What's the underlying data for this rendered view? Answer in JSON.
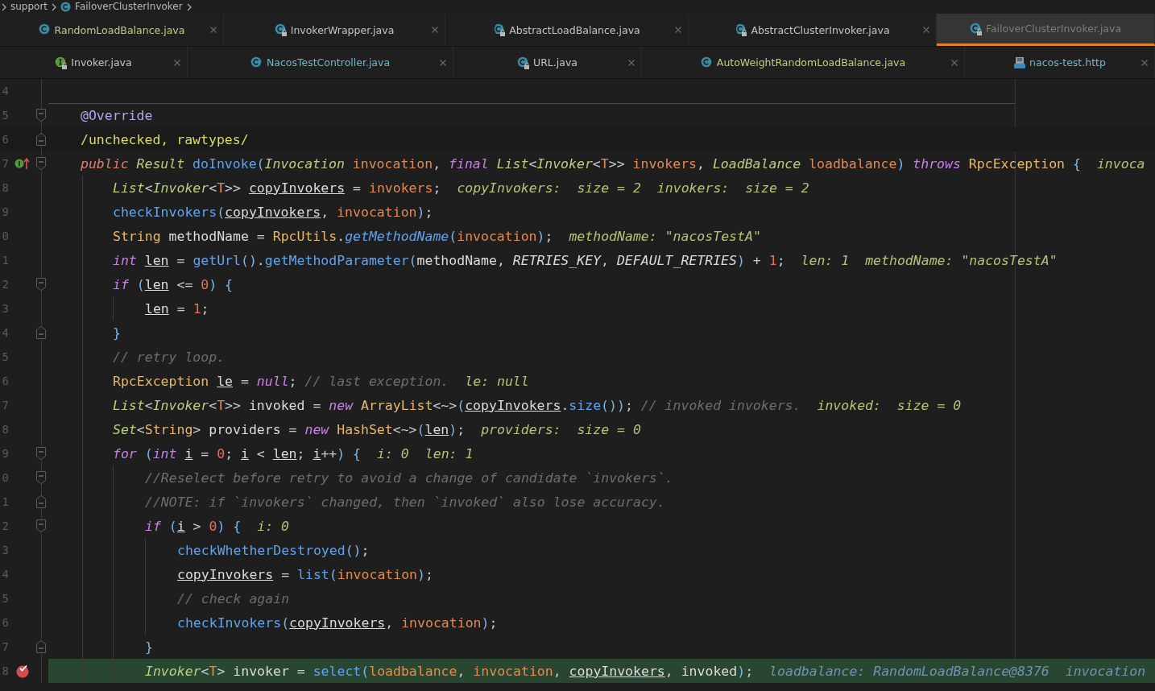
{
  "breadcrumb": [
    "support",
    "FailoverClusterInvoker"
  ],
  "tab_rows": [
    [
      {
        "label": "RandomLoadBalance.java",
        "kind": "class",
        "color": "#b7cf7e",
        "selected": false
      },
      {
        "label": "InvokerWrapper.java",
        "kind": "locked-class",
        "color": "#c4c4c4",
        "selected": false
      },
      {
        "label": "AbstractLoadBalance.java",
        "kind": "locked-abstract",
        "color": "#c4c4c4",
        "selected": false
      },
      {
        "label": "AbstractClusterInvoker.java",
        "kind": "locked-abstract",
        "color": "#c4c4c4",
        "selected": false
      },
      {
        "label": "FailoverClusterInvoker.java",
        "kind": "locked-class",
        "color": "#7d7d7d",
        "selected": true
      }
    ],
    [
      {
        "label": "Invoker.java",
        "kind": "locked-interface",
        "color": "#c4c4c4",
        "selected": false
      },
      {
        "label": "NacosTestController.java",
        "kind": "class",
        "color": "#72b4c8",
        "selected": false
      },
      {
        "label": "URL.java",
        "kind": "locked-class",
        "color": "#c4c4c4",
        "selected": false
      },
      {
        "label": "AutoWeightRandomLoadBalance.java",
        "kind": "class",
        "color": "#b7cf7e",
        "selected": false
      },
      {
        "label": "nacos-test.http",
        "kind": "http",
        "color": "#72b4c8",
        "selected": false
      }
    ]
  ],
  "lines": [
    {
      "number": "4"
    },
    {
      "number": "5",
      "fold_start": true,
      "method_separator": true,
      "tokens": [
        {
          "kind": "ann",
          "text": "@Override"
        }
      ]
    },
    {
      "number": "6",
      "fold_end": true,
      "caret_line": true,
      "tokens": [
        {
          "kind": "sup",
          "text": "/unchecked, rawtypes/"
        }
      ]
    },
    {
      "number": "7",
      "fold_start": true,
      "implements_marker": true,
      "tokens": [
        {
          "kind": "mod",
          "text": "public "
        },
        {
          "kind": "ty",
          "text": "Result "
        },
        {
          "kind": "fn",
          "text": "doInvoke"
        },
        {
          "kind": "br",
          "text": "("
        },
        {
          "kind": "ty",
          "text": "Invocation "
        },
        {
          "kind": "par",
          "text": "invocation"
        },
        {
          "text": ", "
        },
        {
          "kind": "kw",
          "text": "final "
        },
        {
          "kind": "ty",
          "text": "List"
        },
        {
          "text": "<"
        },
        {
          "kind": "ty",
          "text": "Invoker"
        },
        {
          "text": "<"
        },
        {
          "kind": "tp",
          "text": "T"
        },
        {
          "text": ">> "
        },
        {
          "kind": "par",
          "text": "invokers"
        },
        {
          "text": ", "
        },
        {
          "kind": "ty",
          "text": "LoadBalance "
        },
        {
          "kind": "par",
          "text": "loadbalance"
        },
        {
          "kind": "br",
          "text": ")"
        },
        {
          "kind": "kw",
          "text": " throws "
        },
        {
          "kind": "cls",
          "text": "RpcException "
        },
        {
          "kind": "br",
          "text": "{"
        }
      ],
      "hints": [
        "invoca"
      ],
      "children": [
        {
          "number": "8",
          "tokens": [
            {
              "kind": "ty",
              "text": "List"
            },
            {
              "text": "<"
            },
            {
              "kind": "ty",
              "text": "Invoker"
            },
            {
              "text": "<"
            },
            {
              "kind": "tp",
              "text": "T"
            },
            {
              "text": ">> "
            },
            {
              "kind": "u",
              "text": "copyInvokers"
            },
            {
              "text": " = "
            },
            {
              "kind": "par",
              "text": "invokers"
            },
            {
              "text": ";"
            }
          ],
          "hints": [
            "copyInvokers:  size = 2",
            "invokers:  size = 2"
          ]
        },
        {
          "number": "9",
          "tokens": [
            {
              "kind": "fn",
              "text": "checkInvokers"
            },
            {
              "kind": "br",
              "text": "("
            },
            {
              "kind": "u",
              "text": "copyInvokers"
            },
            {
              "text": ", "
            },
            {
              "kind": "par",
              "text": "invocation"
            },
            {
              "kind": "br",
              "text": ")"
            },
            {
              "text": ";"
            }
          ]
        },
        {
          "number": "0",
          "tokens": [
            {
              "kind": "cls",
              "text": "String "
            },
            {
              "kind": "v",
              "text": "methodName"
            },
            {
              "text": " = "
            },
            {
              "kind": "cls",
              "text": "RpcUtils"
            },
            {
              "text": "."
            },
            {
              "kind": "sfn",
              "text": "getMethodName"
            },
            {
              "kind": "br",
              "text": "("
            },
            {
              "kind": "par",
              "text": "invocation"
            },
            {
              "kind": "br",
              "text": ")"
            },
            {
              "text": ";"
            }
          ],
          "hints": [
            "methodName: \"nacosTestA\""
          ]
        },
        {
          "number": "1",
          "tokens": [
            {
              "kind": "kw",
              "text": "int "
            },
            {
              "kind": "u",
              "text": "len"
            },
            {
              "text": " = "
            },
            {
              "kind": "fn",
              "text": "getUrl"
            },
            {
              "kind": "br",
              "text": "()"
            },
            {
              "text": "."
            },
            {
              "kind": "fn",
              "text": "getMethodParameter"
            },
            {
              "kind": "br",
              "text": "("
            },
            {
              "kind": "v",
              "text": "methodName"
            },
            {
              "text": ", "
            },
            {
              "kind": "cst",
              "text": "RETRIES_KEY"
            },
            {
              "text": ", "
            },
            {
              "kind": "cst",
              "text": "DEFAULT_RETRIES"
            },
            {
              "kind": "br",
              "text": ")"
            },
            {
              "text": " + "
            },
            {
              "kind": "num",
              "text": "1"
            },
            {
              "text": ";"
            }
          ],
          "hints": [
            "len: 1",
            "methodName: \"nacosTestA\""
          ]
        },
        {
          "number": "2",
          "fold_start": true,
          "tokens": [
            {
              "kind": "kw",
              "text": "if "
            },
            {
              "kind": "br",
              "text": "("
            },
            {
              "kind": "u",
              "text": "len"
            },
            {
              "text": " <= "
            },
            {
              "kind": "num",
              "text": "0"
            },
            {
              "kind": "br",
              "text": ") {"
            }
          ],
          "children": [
            {
              "number": "3",
              "tokens": [
                {
                  "kind": "u",
                  "text": "len"
                },
                {
                  "text": " = "
                },
                {
                  "kind": "num",
                  "text": "1"
                },
                {
                  "text": ";"
                }
              ]
            }
          ]
        },
        {
          "number": "4",
          "fold_end": true,
          "tokens": [
            {
              "kind": "br",
              "text": "}"
            }
          ]
        },
        {
          "number": "5",
          "tokens": [
            {
              "kind": "cm",
              "text": "// retry loop."
            }
          ]
        },
        {
          "number": "6",
          "tokens": [
            {
              "kind": "cls",
              "text": "RpcException "
            },
            {
              "kind": "u",
              "text": "le"
            },
            {
              "text": " = "
            },
            {
              "kind": "kw",
              "text": "null"
            },
            {
              "text": "; "
            },
            {
              "kind": "cm",
              "text": "// last exception."
            }
          ],
          "hints": [
            "le: null"
          ]
        },
        {
          "number": "7",
          "tokens": [
            {
              "kind": "ty",
              "text": "List"
            },
            {
              "text": "<"
            },
            {
              "kind": "ty",
              "text": "Invoker"
            },
            {
              "text": "<"
            },
            {
              "kind": "tp",
              "text": "T"
            },
            {
              "text": ">> "
            },
            {
              "kind": "v",
              "text": "invoked"
            },
            {
              "text": " = "
            },
            {
              "kind": "kw",
              "text": "new "
            },
            {
              "kind": "cls",
              "text": "ArrayList"
            },
            {
              "text": "<~>"
            },
            {
              "kind": "br",
              "text": "("
            },
            {
              "kind": "u",
              "text": "copyInvokers"
            },
            {
              "text": "."
            },
            {
              "kind": "fn",
              "text": "size"
            },
            {
              "kind": "br",
              "text": "())"
            },
            {
              "text": "; "
            },
            {
              "kind": "cm",
              "text": "// invoked invokers."
            }
          ],
          "hints": [
            "invoked:  size = 0"
          ]
        },
        {
          "number": "8",
          "tokens": [
            {
              "kind": "ty",
              "text": "Set"
            },
            {
              "text": "<"
            },
            {
              "kind": "cls",
              "text": "String"
            },
            {
              "text": "> "
            },
            {
              "kind": "v",
              "text": "providers"
            },
            {
              "text": " = "
            },
            {
              "kind": "kw",
              "text": "new "
            },
            {
              "kind": "cls",
              "text": "HashSet"
            },
            {
              "text": "<~>"
            },
            {
              "kind": "br",
              "text": "("
            },
            {
              "kind": "u",
              "text": "len"
            },
            {
              "kind": "br",
              "text": ")"
            },
            {
              "text": ";"
            }
          ],
          "hints": [
            "providers:  size = 0"
          ]
        },
        {
          "number": "9",
          "fold_start": true,
          "tokens": [
            {
              "kind": "kw",
              "text": "for "
            },
            {
              "kind": "br",
              "text": "("
            },
            {
              "kind": "kw",
              "text": "int "
            },
            {
              "kind": "u",
              "text": "i"
            },
            {
              "text": " = "
            },
            {
              "kind": "num",
              "text": "0"
            },
            {
              "text": "; "
            },
            {
              "kind": "u",
              "text": "i"
            },
            {
              "text": " < "
            },
            {
              "kind": "u",
              "text": "len"
            },
            {
              "text": "; "
            },
            {
              "kind": "u",
              "text": "i"
            },
            {
              "text": "++"
            },
            {
              "kind": "br",
              "text": ") {"
            }
          ],
          "hints": [
            "i: 0",
            "len: 1"
          ],
          "children": [
            {
              "number": "0",
              "fold_start": true,
              "tokens": [
                {
                  "kind": "cm",
                  "text": "//Reselect before retry to avoid a change of candidate `invokers`."
                }
              ]
            },
            {
              "number": "1",
              "fold_end": true,
              "tokens": [
                {
                  "kind": "cm",
                  "text": "//NOTE: if `invokers` changed, then `invoked` also lose accuracy."
                }
              ]
            },
            {
              "number": "2",
              "fold_start": true,
              "tokens": [
                {
                  "kind": "kw",
                  "text": "if "
                },
                {
                  "kind": "br",
                  "text": "("
                },
                {
                  "kind": "u",
                  "text": "i"
                },
                {
                  "text": " > "
                },
                {
                  "kind": "num",
                  "text": "0"
                },
                {
                  "kind": "br",
                  "text": ") {"
                }
              ],
              "hints": [
                "i: 0"
              ],
              "children": [
                {
                  "number": "3",
                  "tokens": [
                    {
                      "kind": "fn",
                      "text": "checkWhetherDestroyed"
                    },
                    {
                      "kind": "br",
                      "text": "()"
                    },
                    {
                      "text": ";"
                    }
                  ]
                },
                {
                  "number": "4",
                  "tokens": [
                    {
                      "kind": "u",
                      "text": "copyInvokers"
                    },
                    {
                      "text": " = "
                    },
                    {
                      "kind": "fn",
                      "text": "list"
                    },
                    {
                      "kind": "br",
                      "text": "("
                    },
                    {
                      "kind": "par",
                      "text": "invocation"
                    },
                    {
                      "kind": "br",
                      "text": ")"
                    },
                    {
                      "text": ";"
                    }
                  ]
                },
                {
                  "number": "5",
                  "tokens": [
                    {
                      "kind": "cm",
                      "text": "// check again"
                    }
                  ]
                },
                {
                  "number": "6",
                  "tokens": [
                    {
                      "kind": "fn",
                      "text": "checkInvokers"
                    },
                    {
                      "kind": "br",
                      "text": "("
                    },
                    {
                      "kind": "u",
                      "text": "copyInvokers"
                    },
                    {
                      "text": ", "
                    },
                    {
                      "kind": "par",
                      "text": "invocation"
                    },
                    {
                      "kind": "br",
                      "text": ")"
                    },
                    {
                      "text": ";"
                    }
                  ]
                }
              ]
            },
            {
              "number": "7",
              "fold_end": true,
              "tokens": [
                {
                  "kind": "br",
                  "text": "}"
                }
              ]
            },
            {
              "number": "8",
              "current_line": true,
              "breakpoint": true,
              "tokens": [
                {
                  "kind": "ty",
                  "text": "Invoker"
                },
                {
                  "text": "<"
                },
                {
                  "kind": "tp",
                  "text": "T"
                },
                {
                  "text": "> "
                },
                {
                  "kind": "v",
                  "text": "invoker"
                },
                {
                  "text": " = "
                },
                {
                  "kind": "fn",
                  "text": "select"
                },
                {
                  "kind": "br",
                  "text": "("
                },
                {
                  "kind": "par",
                  "text": "loadbalance"
                },
                {
                  "text": ", "
                },
                {
                  "kind": "par",
                  "text": "invocation"
                },
                {
                  "text": ", "
                },
                {
                  "kind": "u",
                  "text": "copyInvokers"
                },
                {
                  "text": ", "
                },
                {
                  "kind": "v",
                  "text": "invoked"
                },
                {
                  "kind": "br",
                  "text": ")"
                },
                {
                  "text": ";"
                }
              ],
              "hints": [
                "loadbalance: RandomLoadBalance@8376",
                "invocation"
              ]
            }
          ]
        }
      ]
    }
  ]
}
